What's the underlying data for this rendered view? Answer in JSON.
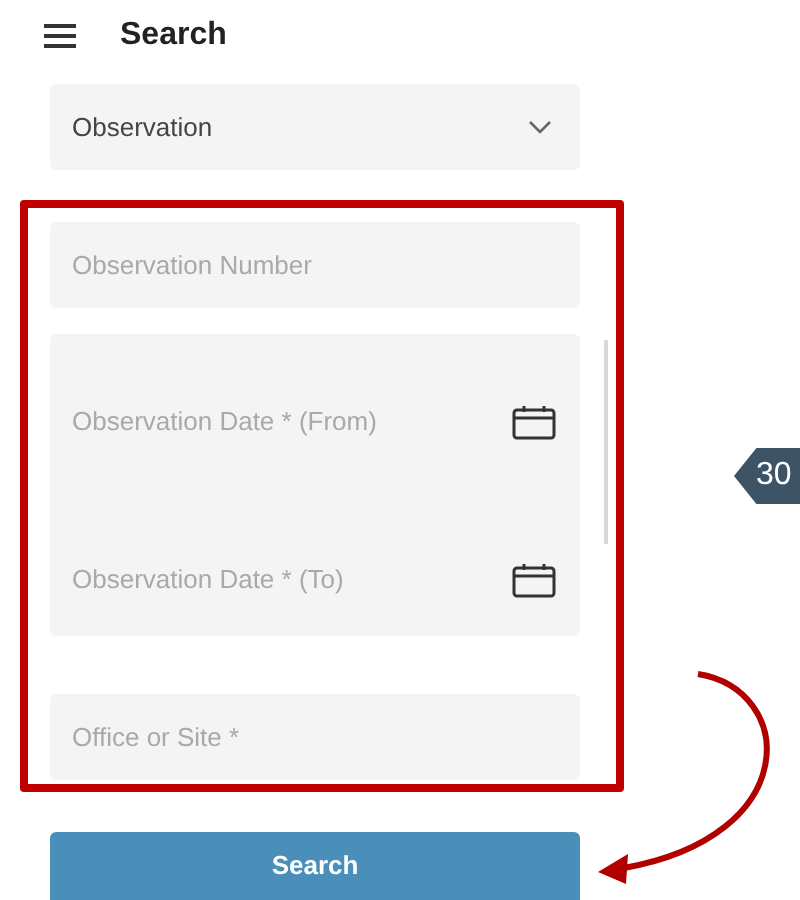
{
  "header": {
    "title": "Search"
  },
  "type_dropdown": {
    "value": "Observation"
  },
  "fields": [
    {
      "kind": "text",
      "placeholder": "Observation Number"
    },
    {
      "kind": "date_range",
      "from": {
        "placeholder": "Observation Date * (From)"
      },
      "to": {
        "placeholder": "Observation Date * (To)"
      }
    },
    {
      "kind": "text",
      "placeholder": "Office or Site *"
    }
  ],
  "search_button": {
    "label": "Search"
  },
  "callout": {
    "label": "30"
  }
}
